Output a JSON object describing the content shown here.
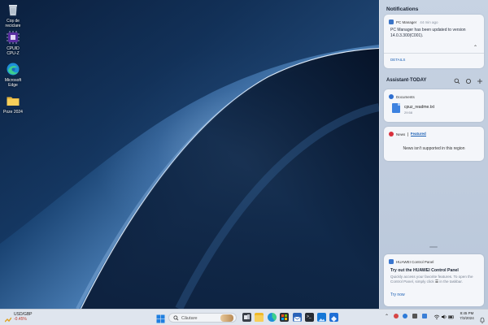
{
  "desktop": {
    "icons": [
      {
        "label": "Coș de reciclare",
        "icon": "recycle-bin-icon"
      },
      {
        "label": "CPUID CPU-Z",
        "icon": "cpu-z-icon"
      },
      {
        "label": "Microsoft Edge",
        "icon": "edge-icon"
      },
      {
        "label": "Poze 2024",
        "icon": "folder-icon"
      }
    ]
  },
  "panel": {
    "notifications_title": "Notifications",
    "notification": {
      "app": "PC Manager",
      "time": "44 min ago",
      "message": "PC Manager has been updated to version 14.0.3.300(C001).",
      "details_label": "DETAILS"
    },
    "assistant": {
      "title": "Assistant·TODAY",
      "documents": {
        "header": "Documents",
        "file_name": "cpuz_readme.txt",
        "file_time": "29:58"
      },
      "news": {
        "header": "News",
        "tab": "Featured",
        "message": "News isn't supported in this region"
      }
    },
    "control_panel": {
      "header": "HUAWEI Control Panel",
      "title": "Try out the HUAWEI Control Panel",
      "body": "Quickly access your favorite features. To open the Control Panel, simply click",
      "body_tail": "in the taskbar.",
      "cta": "Try now"
    }
  },
  "taskbar": {
    "weather": {
      "ticker": "USD/GBP",
      "change": "-0.45%"
    },
    "search_placeholder": "Căutare",
    "clock": {
      "time": "8:45 PM",
      "date": "7/3/2024"
    }
  },
  "colors": {
    "accent": "#1a5fb4",
    "panel_bg": "#c5d1e2",
    "taskbar_bg": "#dfe5ee"
  }
}
